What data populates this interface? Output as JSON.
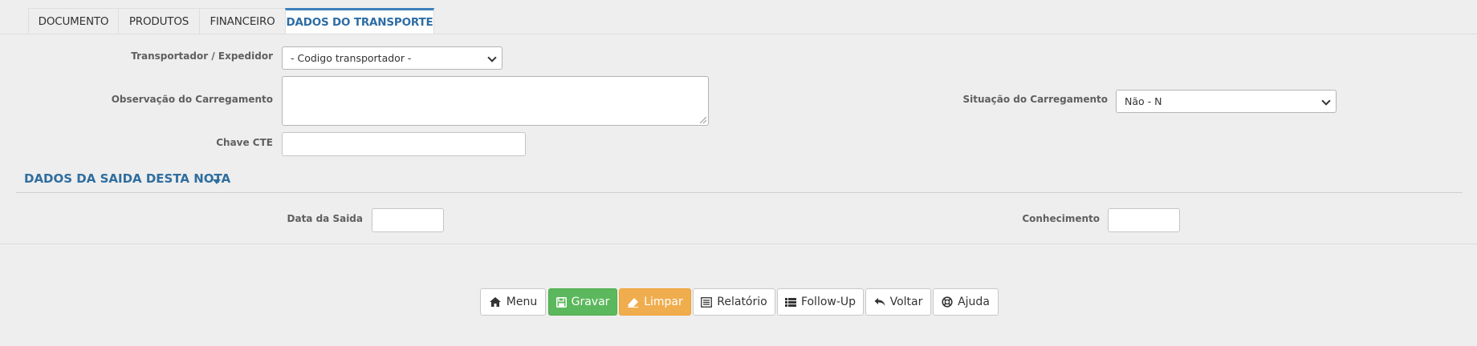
{
  "tabs": [
    "DOCUMENTO",
    "PRODUTOS",
    "FINANCEIRO",
    "DADOS DO TRANSPORTE"
  ],
  "active_tab": "DADOS DO TRANSPORTE",
  "form": {
    "transportador_label": "Transportador / Expedidor",
    "transportador_value": "- Codigo transportador -",
    "observacao_label": "Observação do Carregamento",
    "observacao_value": "",
    "situacao_label": "Situação do Carregamento",
    "situacao_value": "Não - N",
    "chave_label": "Chave CTE",
    "chave_value": ""
  },
  "section": {
    "title": "DADOS DA SAIDA DESTA NOTA",
    "data_saida_label": "Data da Saida",
    "data_saida_value": "",
    "conhecimento_label": "Conhecimento",
    "conhecimento_value": ""
  },
  "buttons": {
    "menu": "Menu",
    "gravar": "Gravar",
    "limpar": "Limpar",
    "relatorio": "Relatório",
    "followup": "Follow-Up",
    "voltar": "Voltar",
    "ajuda": "Ajuda"
  },
  "colors": {
    "accent": "#2f6e9f",
    "success": "#5cb85c",
    "warning": "#f0ad4e"
  },
  "icons": [
    "home-icon",
    "save-icon",
    "eraser-icon",
    "list-alt-icon",
    "list-icon",
    "reply-icon",
    "life-ring-icon",
    "caret-down-icon"
  ]
}
